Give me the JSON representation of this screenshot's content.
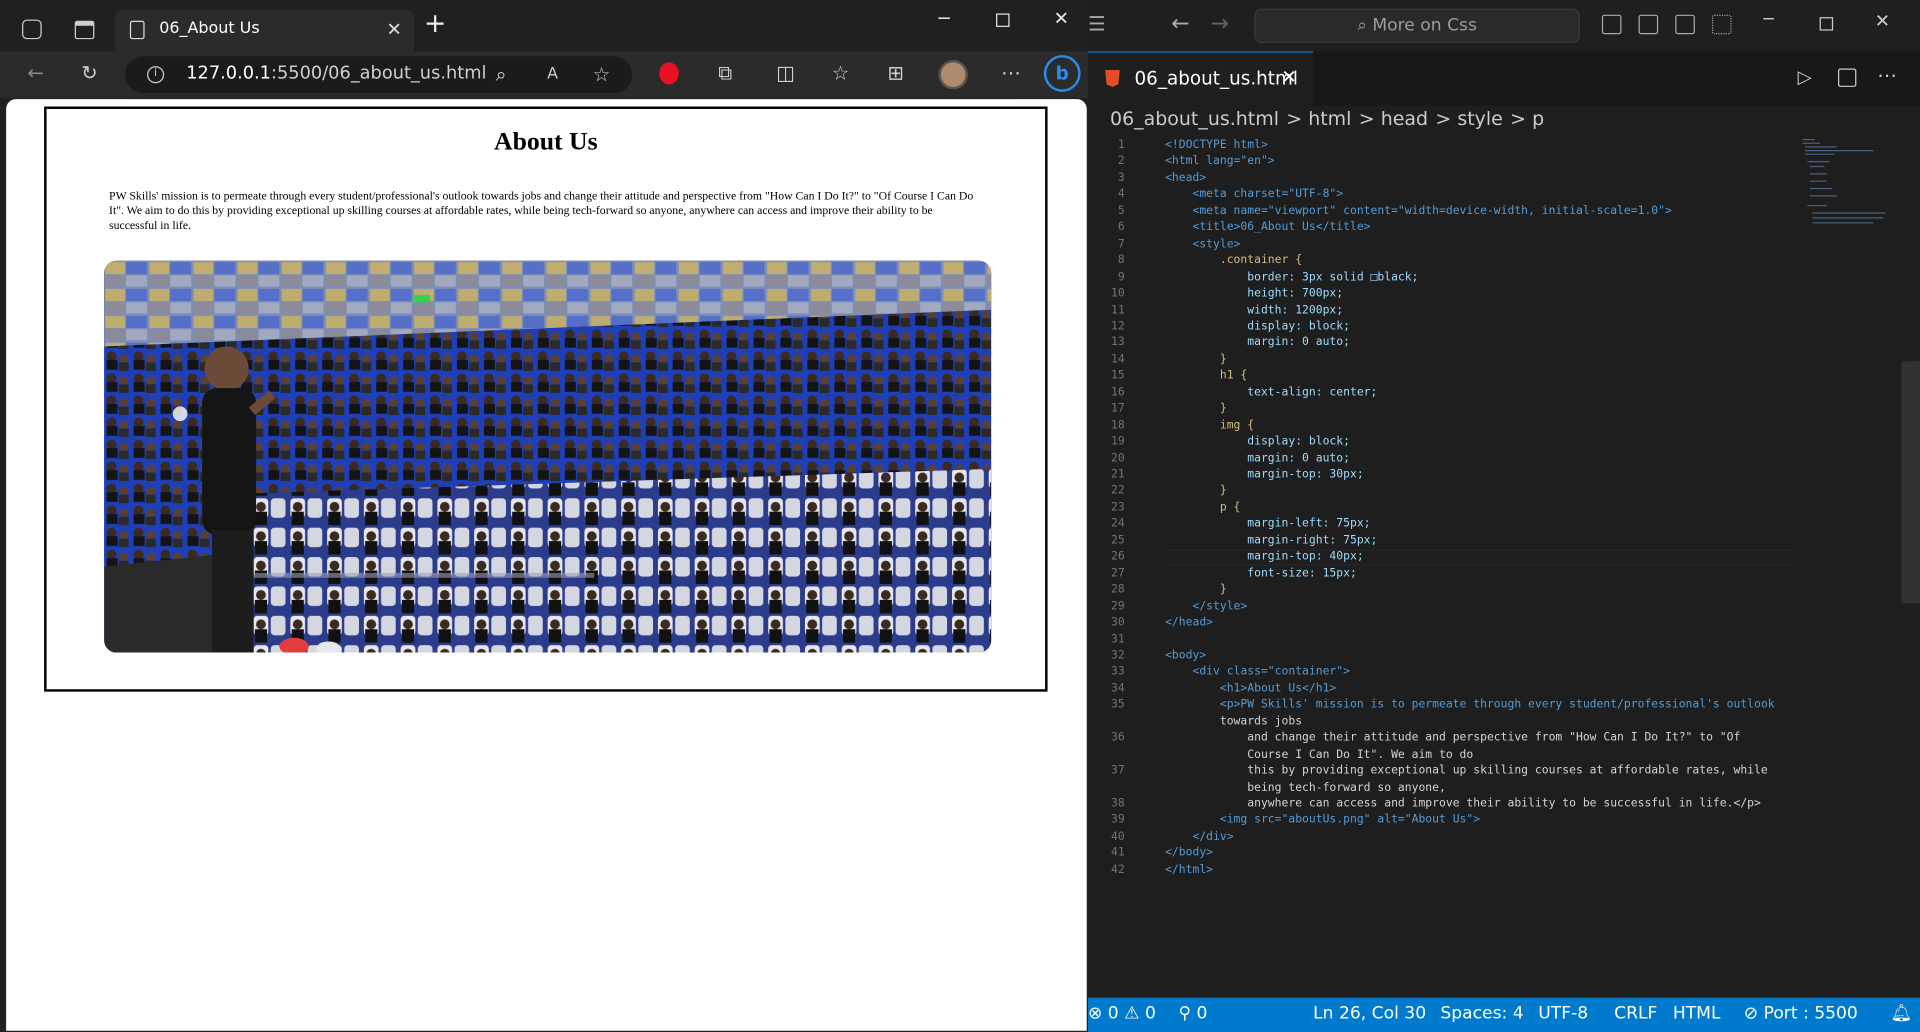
{
  "browser": {
    "tab_title": "06_About Us",
    "new_tab_symbol": "+",
    "url_host": "127.0.0.1",
    "url_path": ":5500/06_about_us.html",
    "icons": [
      "workspaces-icon",
      "tab-actions-icon",
      "page-icon",
      "close-icon",
      "back-icon",
      "refresh-icon",
      "info-icon",
      "zoom-icon",
      "read-aloud-icon",
      "favorite-icon",
      "shield-icon",
      "extensions-icon",
      "split-screen-icon",
      "favorites-icon",
      "collections-icon",
      "avatar",
      "more-icon",
      "bing-icon"
    ],
    "page": {
      "heading": "About Us",
      "paragraph": "PW Skills' mission is to permeate through every student/professional's outlook towards jobs and change their attitude and perspective from \"How Can I Do It?\" to \"Of Course I Can Do It\". We aim to do this by providing exceptional up skilling courses at affordable rates, while being tech-forward so anyone, anywhere can access and improve their ability to be successful in life.",
      "image_alt": "About Us"
    }
  },
  "editor": {
    "search_placeholder": "More on Css",
    "tab_title": "06_about_us.html",
    "breadcrumb": [
      "06_about_us.html",
      "html",
      "head",
      "style",
      "p"
    ],
    "lines": [
      "<!DOCTYPE html>",
      "<html lang=\"en\">",
      "<head>",
      "    <meta charset=\"UTF-8\">",
      "    <meta name=\"viewport\" content=\"width=device-width, initial-scale=1.0\">",
      "    <title>06_About Us</title>",
      "    <style>",
      "        .container {",
      "            border: 3px solid □black;",
      "            height: 700px;",
      "            width: 1200px;",
      "            display: block;",
      "            margin: 0 auto;",
      "        }",
      "        h1 {",
      "            text-align: center;",
      "        }",
      "        img {",
      "            display: block;",
      "            margin: 0 auto;",
      "            margin-top: 30px;",
      "        }",
      "        p {",
      "            margin-left: 75px;",
      "            margin-right: 75px;",
      "            margin-top: 40px;",
      "            font-size: 15px;",
      "        }",
      "    </style>",
      "</head>",
      "",
      "<body>",
      "    <div class=\"container\">",
      "        <h1>About Us</h1>",
      "        <p>PW Skills' mission is to permeate through every student/professional's outlook",
      "        towards jobs",
      "            and change their attitude and perspective from \"How Can I Do It?\" to \"Of",
      "            Course I Can Do It\". We aim to do",
      "            this by providing exceptional up skilling courses at affordable rates, while",
      "            being tech-forward so anyone,",
      "            anywhere can access and improve their ability to be successful in life.</p>",
      "        <img src=\"aboutUs.png\" alt=\"About Us\">",
      "    </div>",
      "</body>",
      "</html>"
    ],
    "line_numbers": [
      "1",
      "2",
      "3",
      "4",
      "5",
      "6",
      "7",
      "8",
      "9",
      "10",
      "11",
      "12",
      "13",
      "14",
      "15",
      "16",
      "17",
      "18",
      "19",
      "20",
      "21",
      "22",
      "23",
      "24",
      "25",
      "26",
      "27",
      "28",
      "29",
      "30",
      "31",
      "32",
      "33",
      "34",
      "35",
      "",
      "36",
      "",
      "37",
      "",
      "38",
      "39",
      "40",
      "41",
      "42"
    ],
    "status": {
      "errors": "0",
      "warnings": "0",
      "ports": "0",
      "position": "Ln 26, Col 30",
      "spaces": "Spaces: 4",
      "encoding": "UTF-8",
      "eol": "CRLF",
      "language": "HTML",
      "port": "Port : 5500"
    }
  },
  "colors": {
    "accent": "#007acc",
    "tag": "#569cd6",
    "attr": "#9cdcfe",
    "string": "#ce9178",
    "number": "#b5cea8"
  }
}
